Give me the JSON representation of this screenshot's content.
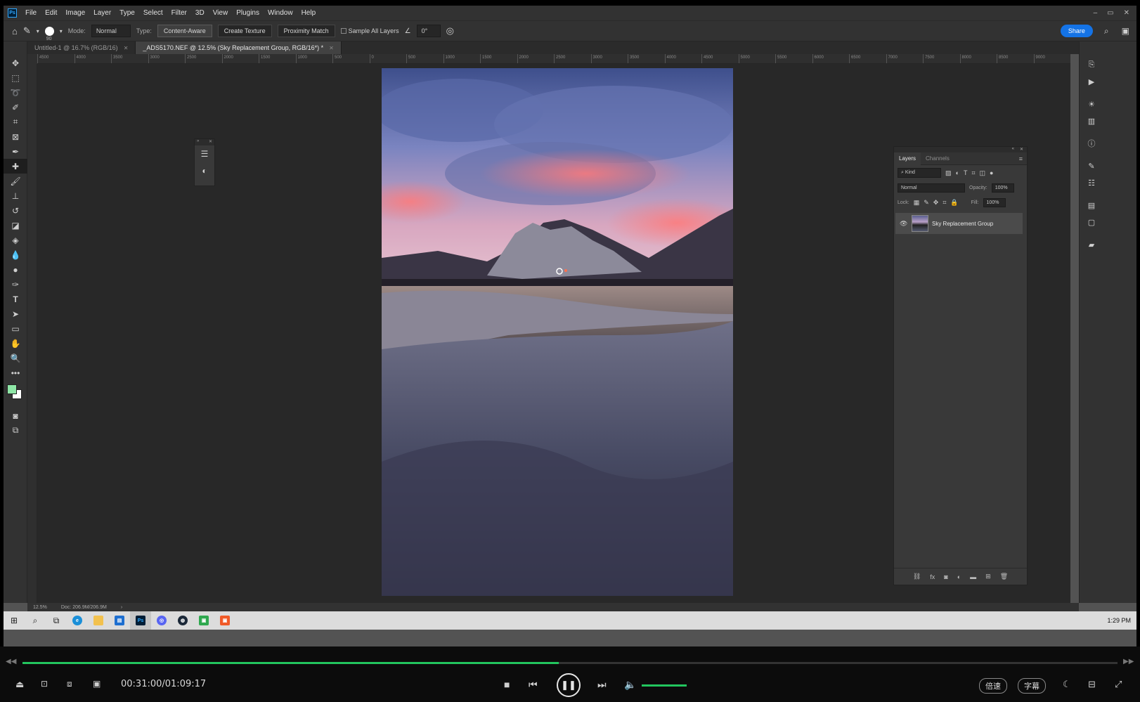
{
  "menubar": {
    "logo": "Ps",
    "items": [
      "File",
      "Edit",
      "Image",
      "Layer",
      "Type",
      "Select",
      "Filter",
      "3D",
      "View",
      "Plugins",
      "Window",
      "Help"
    ],
    "win_controls": [
      "–",
      "▭",
      "✕"
    ]
  },
  "options": {
    "brush_size": "90",
    "mode_label": "Mode:",
    "mode_value": "Normal",
    "type_label": "Type:",
    "type_buttons": [
      "Content-Aware",
      "Create Texture",
      "Proximity Match"
    ],
    "sample_all_layers": "Sample All Layers",
    "angle_value": "0°",
    "share_label": "Share"
  },
  "tabs": [
    {
      "label": "Untitled-1 @ 16.7% (RGB/16)",
      "active": false
    },
    {
      "label": "_ADS5170.NEF @ 12.5% (Sky Replacement Group, RGB/16*) *",
      "active": true
    }
  ],
  "ruler_ticks": [
    "4500",
    "4000",
    "3500",
    "3000",
    "2500",
    "2000",
    "1500",
    "1000",
    "500",
    "0",
    "500",
    "1000",
    "1500",
    "2000",
    "2500",
    "3000",
    "3500",
    "4000",
    "4500",
    "5000",
    "5500",
    "6000",
    "6500",
    "7000",
    "7500",
    "8000",
    "8500",
    "9000"
  ],
  "layers_panel": {
    "tabs": [
      "Layers",
      "Channels"
    ],
    "filter_kind": "Kind",
    "blend_mode": "Normal",
    "opacity_label": "Opacity:",
    "opacity_value": "100%",
    "lock_label": "Lock:",
    "fill_label": "Fill:",
    "fill_value": "100%",
    "layer_name": "Sky Replacement Group"
  },
  "status": {
    "zoom": "12.5%",
    "doc_info": "Doc: 206.9M/206.9M"
  },
  "taskbar": {
    "time": "1:29 PM"
  },
  "player": {
    "time": "00:31:00/01:09:17",
    "progress": 0.49,
    "volume": 1.0,
    "speed_label": "倍速",
    "subtitle_label": "字幕"
  },
  "colors": {
    "foreground": "#8ee6a6",
    "background": "#ffffff",
    "accent": "#1473e6",
    "progress": "#22c55e"
  }
}
